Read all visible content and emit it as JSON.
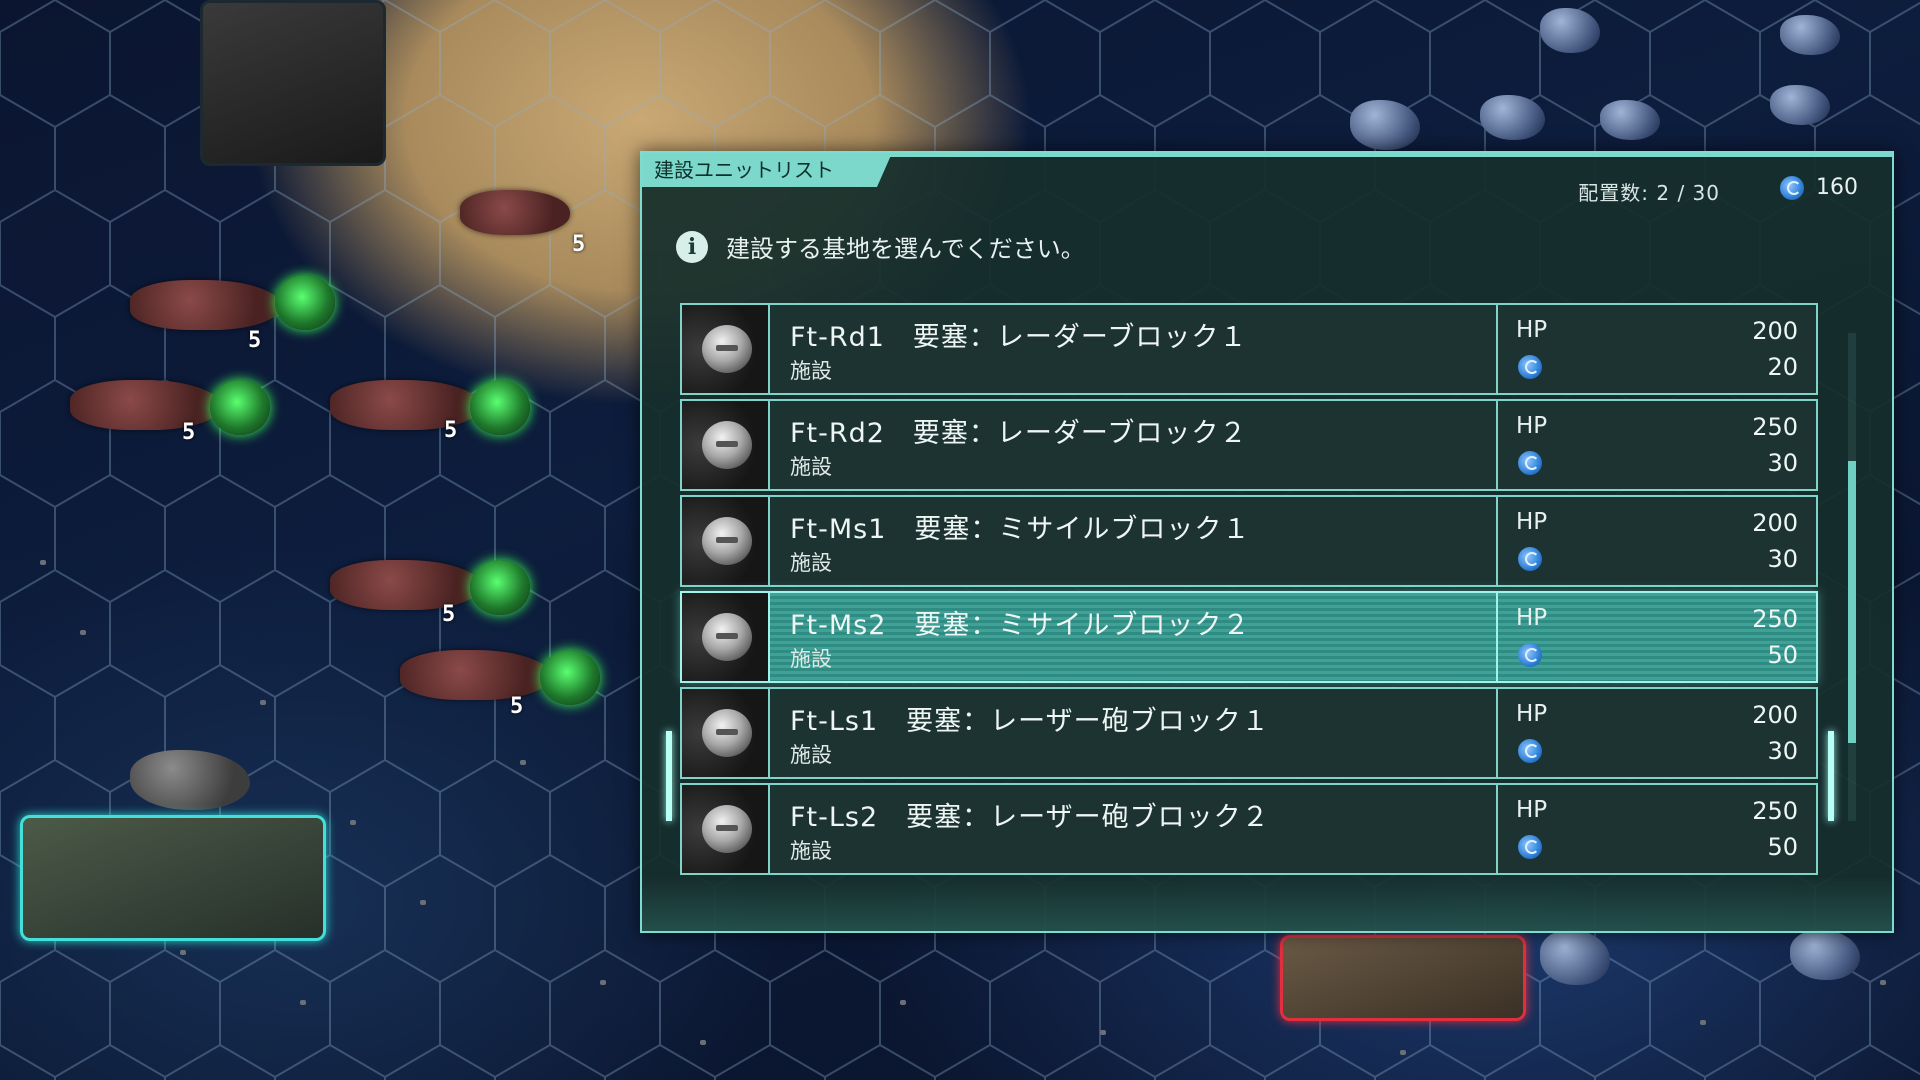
{
  "panel": {
    "title": "建設ユニットリスト",
    "deploy_count": "配置数: 2 / 30",
    "resource_value": "160",
    "info_text": "建設する基地を選んでください。"
  },
  "units": [
    {
      "name": "Ft-Rd1　要塞：レーダーブロック１",
      "type": "施設",
      "hp_label": "HP",
      "hp": "200",
      "cost": "20",
      "selected": false
    },
    {
      "name": "Ft-Rd2　要塞：レーダーブロック２",
      "type": "施設",
      "hp_label": "HP",
      "hp": "250",
      "cost": "30",
      "selected": false
    },
    {
      "name": "Ft-Ms1　要塞：ミサイルブロック１",
      "type": "施設",
      "hp_label": "HP",
      "hp": "200",
      "cost": "30",
      "selected": false
    },
    {
      "name": "Ft-Ms2　要塞：ミサイルブロック２",
      "type": "施設",
      "hp_label": "HP",
      "hp": "250",
      "cost": "50",
      "selected": true
    },
    {
      "name": "Ft-Ls1　要塞：レーザー砲ブロック１",
      "type": "施設",
      "hp_label": "HP",
      "hp": "200",
      "cost": "30",
      "selected": false
    },
    {
      "name": "Ft-Ls2　要塞：レーザー砲ブロック２",
      "type": "施設",
      "hp_label": "HP",
      "hp": "250",
      "cost": "50",
      "selected": false
    }
  ],
  "map": {
    "unit_counts": [
      "5",
      "5",
      "5",
      "5",
      "5",
      "5"
    ]
  },
  "colors": {
    "panel_bg": "#172e2c",
    "accent": "#7cd8cb",
    "selected_row": "#3fa197",
    "resource_icon": "#2e7fd6"
  }
}
